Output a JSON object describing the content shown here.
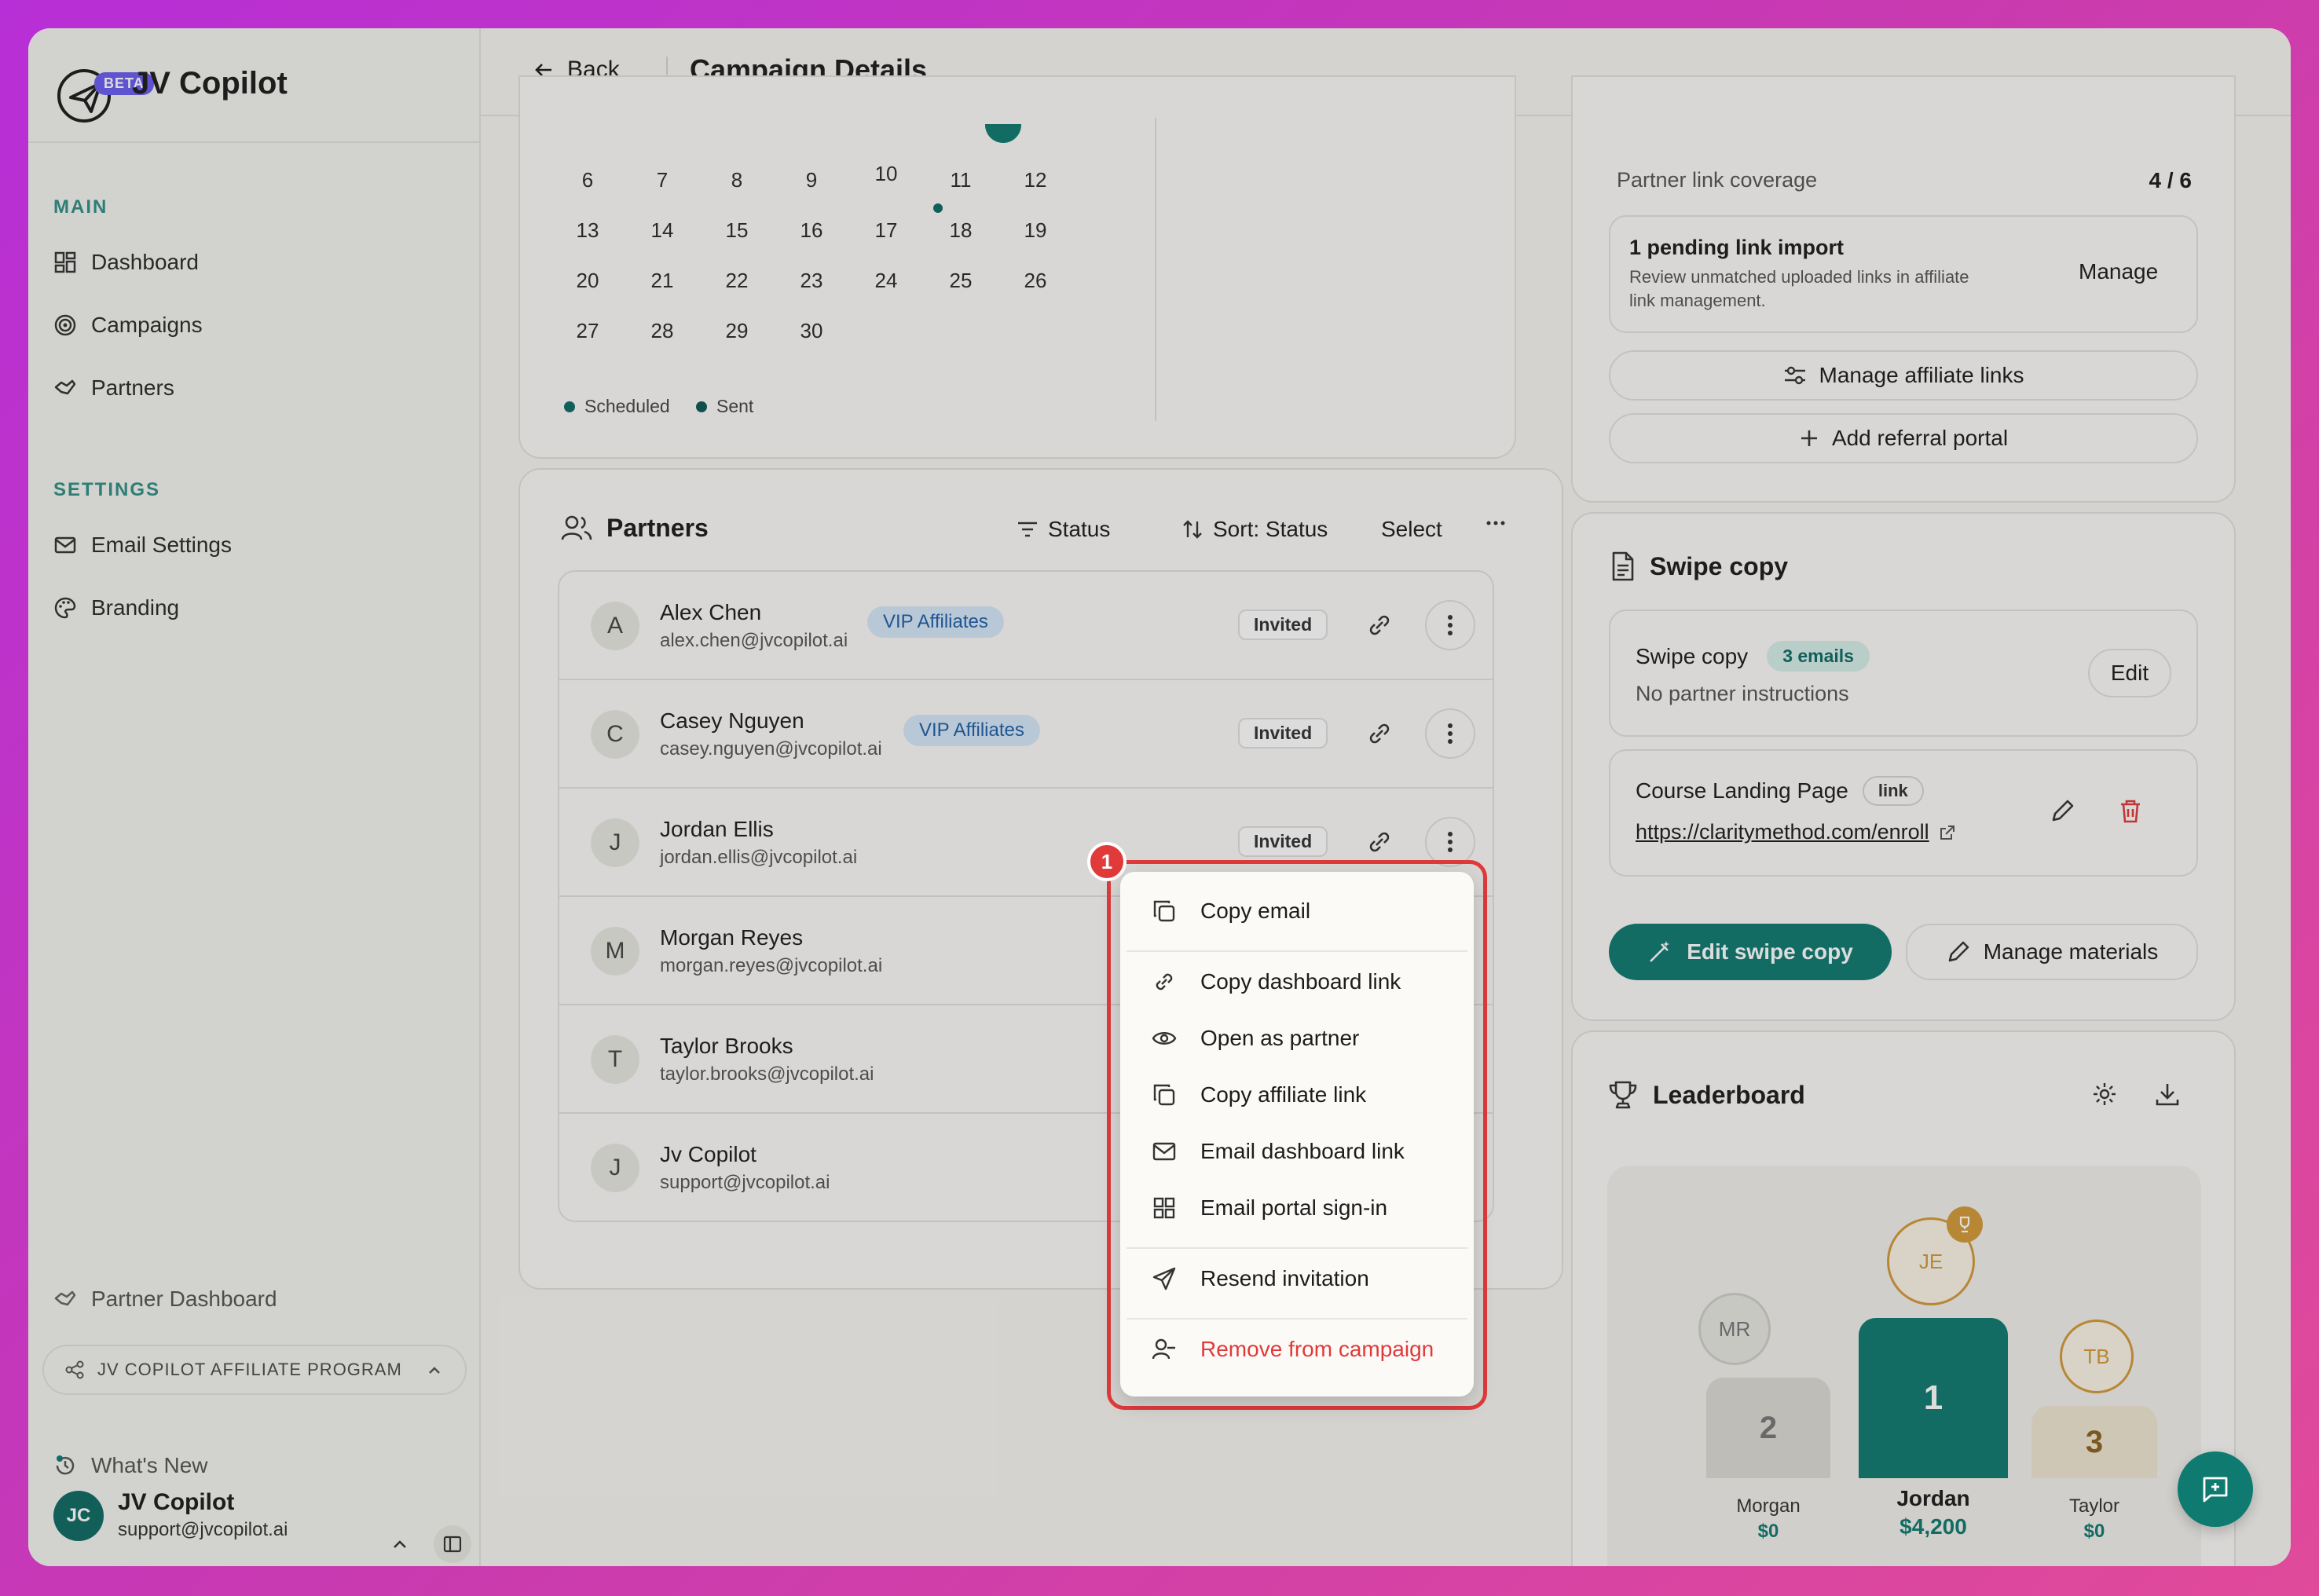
{
  "app": {
    "name": "JV Copilot",
    "beta": "BETA"
  },
  "sidebar": {
    "main_label": "MAIN",
    "settings_label": "SETTINGS",
    "items": [
      {
        "label": "Dashboard",
        "icon": "dashboard-icon"
      },
      {
        "label": "Campaigns",
        "icon": "target-icon"
      },
      {
        "label": "Partners",
        "icon": "handshake-icon"
      },
      {
        "label": "Email Settings",
        "icon": "mail-icon"
      },
      {
        "label": "Branding",
        "icon": "palette-icon"
      }
    ],
    "partner_dashboard": "Partner Dashboard",
    "program": "JV COPILOT AFFILIATE PROGRAM",
    "whats_new": "What's New",
    "user": {
      "initials": "JC",
      "name": "JV Copilot",
      "email": "support@jvcopilot.ai"
    }
  },
  "topbar": {
    "back": "Back",
    "title": "Campaign Details"
  },
  "calendar": {
    "rows": [
      [
        "6",
        "7",
        "8",
        "9",
        "10",
        "11",
        "12"
      ],
      [
        "13",
        "14",
        "15",
        "16",
        "17",
        "18",
        "19"
      ],
      [
        "20",
        "21",
        "22",
        "23",
        "24",
        "25",
        "26"
      ],
      [
        "27",
        "28",
        "29",
        "30"
      ]
    ],
    "legend": [
      "Scheduled",
      "Sent"
    ]
  },
  "partners": {
    "title": "Partners",
    "tools": {
      "status": "Status",
      "sort": "Sort: Status",
      "select": "Select"
    },
    "rows": [
      {
        "initial": "A",
        "name": "Alex Chen",
        "email": "alex.chen@jvcopilot.ai",
        "group": "VIP Affiliates",
        "status": "Invited"
      },
      {
        "initial": "C",
        "name": "Casey Nguyen",
        "email": "casey.nguyen@jvcopilot.ai",
        "group": "VIP Affiliates",
        "status": "Invited"
      },
      {
        "initial": "J",
        "name": "Jordan Ellis",
        "email": "jordan.ellis@jvcopilot.ai",
        "group": "",
        "status": "Invited"
      },
      {
        "initial": "M",
        "name": "Morgan Reyes",
        "email": "morgan.reyes@jvcopilot.ai",
        "group": "",
        "status": ""
      },
      {
        "initial": "T",
        "name": "Taylor Brooks",
        "email": "taylor.brooks@jvcopilot.ai",
        "group": "",
        "status": ""
      },
      {
        "initial": "J",
        "name": "Jv Copilot",
        "email": "support@jvcopilot.ai",
        "group": "",
        "status": ""
      }
    ]
  },
  "links": {
    "coverage_label": "Partner link coverage",
    "coverage_value": "4 / 6",
    "pending_title": "1 pending link import",
    "pending_desc_1": "Review unmatched uploaded links in affiliate",
    "pending_desc_2": "link management.",
    "manage": "Manage",
    "manage_affiliate": "Manage affiliate links",
    "add_portal": "Add referral portal"
  },
  "swipe": {
    "title": "Swipe copy",
    "item_label": "Swipe copy",
    "item_badge": "3 emails",
    "item_sub": "No partner instructions",
    "edit": "Edit",
    "landing_label": "Course Landing Page",
    "landing_badge": "link",
    "landing_url": "https://claritymethod.com/enroll",
    "edit_swipe": "Edit swipe copy",
    "manage_materials": "Manage materials"
  },
  "leaderboard": {
    "title": "Leaderboard",
    "entries": [
      {
        "rank": "2",
        "initials": "MR",
        "name": "Morgan",
        "amount": "$0"
      },
      {
        "rank": "1",
        "initials": "JE",
        "name": "Jordan",
        "amount": "$4,200"
      },
      {
        "rank": "3",
        "initials": "TB",
        "name": "Taylor",
        "amount": "$0"
      }
    ]
  },
  "context_menu": {
    "marker": "1",
    "items": [
      {
        "label": "Copy email",
        "icon": "copy-icon"
      },
      {
        "label": "Copy dashboard link",
        "icon": "link-icon"
      },
      {
        "label": "Open as partner",
        "icon": "eye-icon"
      },
      {
        "label": "Copy affiliate link",
        "icon": "copy-icon"
      },
      {
        "label": "Email dashboard link",
        "icon": "mail-icon"
      },
      {
        "label": "Email portal sign-in",
        "icon": "grid-icon"
      },
      {
        "label": "Resend invitation",
        "icon": "send-icon"
      },
      {
        "label": "Remove from campaign",
        "icon": "user-minus-icon"
      }
    ]
  },
  "colors": {
    "accent": "#0f7a70",
    "danger": "#e03a3a",
    "vip_bg": "#d6e8f8"
  }
}
